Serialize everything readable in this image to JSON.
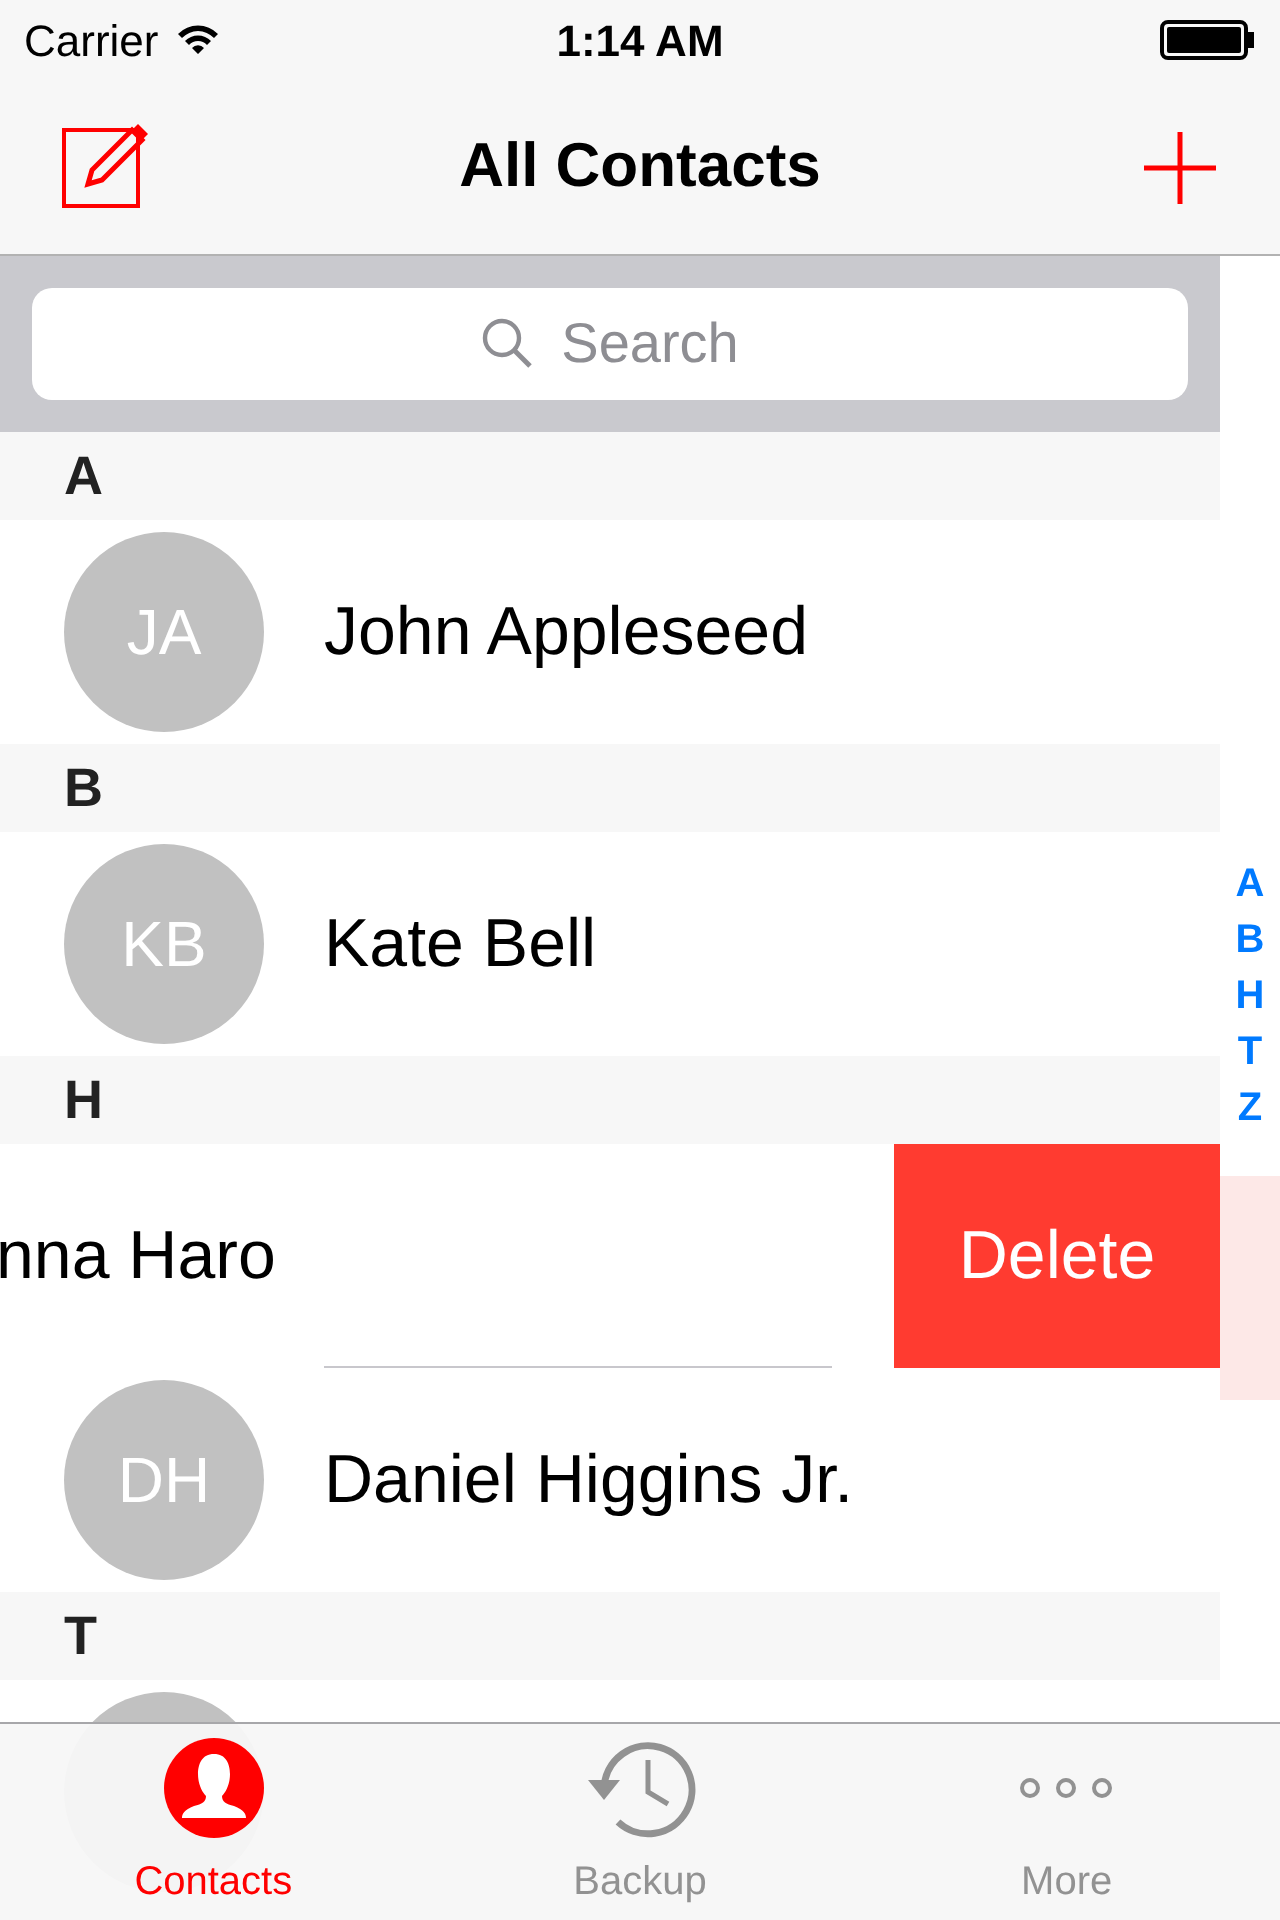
{
  "status_bar": {
    "carrier": "Carrier",
    "time": "1:14 AM"
  },
  "nav_bar": {
    "title": "All Contacts"
  },
  "search": {
    "placeholder": "Search"
  },
  "sections": [
    {
      "letter": "A",
      "contacts": [
        {
          "initials": "JA",
          "name": "John Appleseed",
          "swiped": false
        }
      ]
    },
    {
      "letter": "B",
      "contacts": [
        {
          "initials": "KB",
          "name": "Kate Bell",
          "swiped": false
        }
      ]
    },
    {
      "letter": "H",
      "contacts": [
        {
          "name": "nna Haro",
          "swiped": true,
          "action": "Delete"
        },
        {
          "initials": "DH",
          "name": "Daniel Higgins Jr.",
          "swiped": false
        }
      ]
    },
    {
      "letter": "T",
      "contacts": [
        {
          "swiped": false
        }
      ]
    }
  ],
  "index": [
    "A",
    "B",
    "H",
    "T",
    "Z"
  ],
  "tabs": [
    {
      "kind": "contacts",
      "label": "Contacts",
      "selected": true
    },
    {
      "kind": "backup",
      "label": "Backup",
      "selected": false
    },
    {
      "kind": "more",
      "label": "More",
      "selected": false
    }
  ]
}
